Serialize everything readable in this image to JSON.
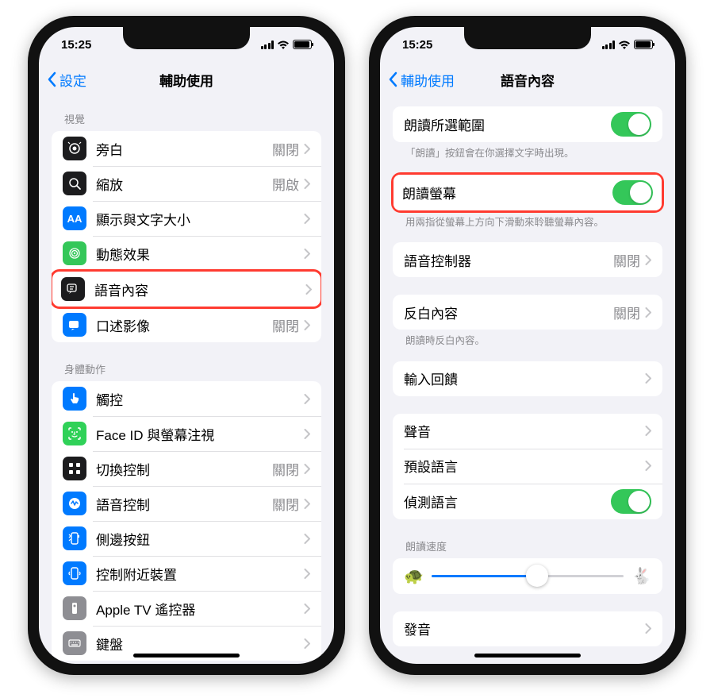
{
  "status": {
    "time": "15:25"
  },
  "left": {
    "back": "設定",
    "title": "輔助使用",
    "section1_header": "視覺",
    "rows1": {
      "voiceover": {
        "label": "旁白",
        "value": "關閉"
      },
      "zoom": {
        "label": "縮放",
        "value": "開啟"
      },
      "display": {
        "label": "顯示與文字大小",
        "value": ""
      },
      "motion": {
        "label": "動態效果",
        "value": ""
      },
      "spoken": {
        "label": "語音內容",
        "value": ""
      },
      "audiodesc": {
        "label": "口述影像",
        "value": "關閉"
      }
    },
    "section2_header": "身體動作",
    "rows2": {
      "touch": {
        "label": "觸控",
        "value": ""
      },
      "faceid": {
        "label": "Face ID 與螢幕注視",
        "value": ""
      },
      "switch": {
        "label": "切換控制",
        "value": "關閉"
      },
      "voice": {
        "label": "語音控制",
        "value": "關閉"
      },
      "side": {
        "label": "側邊按鈕",
        "value": ""
      },
      "nearby": {
        "label": "控制附近裝置",
        "value": ""
      },
      "atv": {
        "label": "Apple TV 遙控器",
        "value": ""
      },
      "keyboard": {
        "label": "鍵盤",
        "value": ""
      }
    }
  },
  "right": {
    "back": "輔助使用",
    "title": "語音內容",
    "speak_selection": {
      "label": "朗讀所選範圍"
    },
    "speak_selection_footer": "「朗讀」按鈕會在你選擇文字時出現。",
    "speak_screen": {
      "label": "朗讀螢幕"
    },
    "speak_screen_footer": "用兩指從螢幕上方向下滑動來聆聽螢幕內容。",
    "speech_controller": {
      "label": "語音控制器",
      "value": "關閉"
    },
    "highlight_content": {
      "label": "反白內容",
      "value": "關閉"
    },
    "highlight_footer": "朗讀時反白內容。",
    "typing_feedback": {
      "label": "輸入回饋"
    },
    "voices": {
      "label": "聲音"
    },
    "default_lang": {
      "label": "預設語言"
    },
    "detect_lang": {
      "label": "偵測語言"
    },
    "rate_header": "朗讀速度",
    "pronunciation": {
      "label": "發音"
    }
  }
}
